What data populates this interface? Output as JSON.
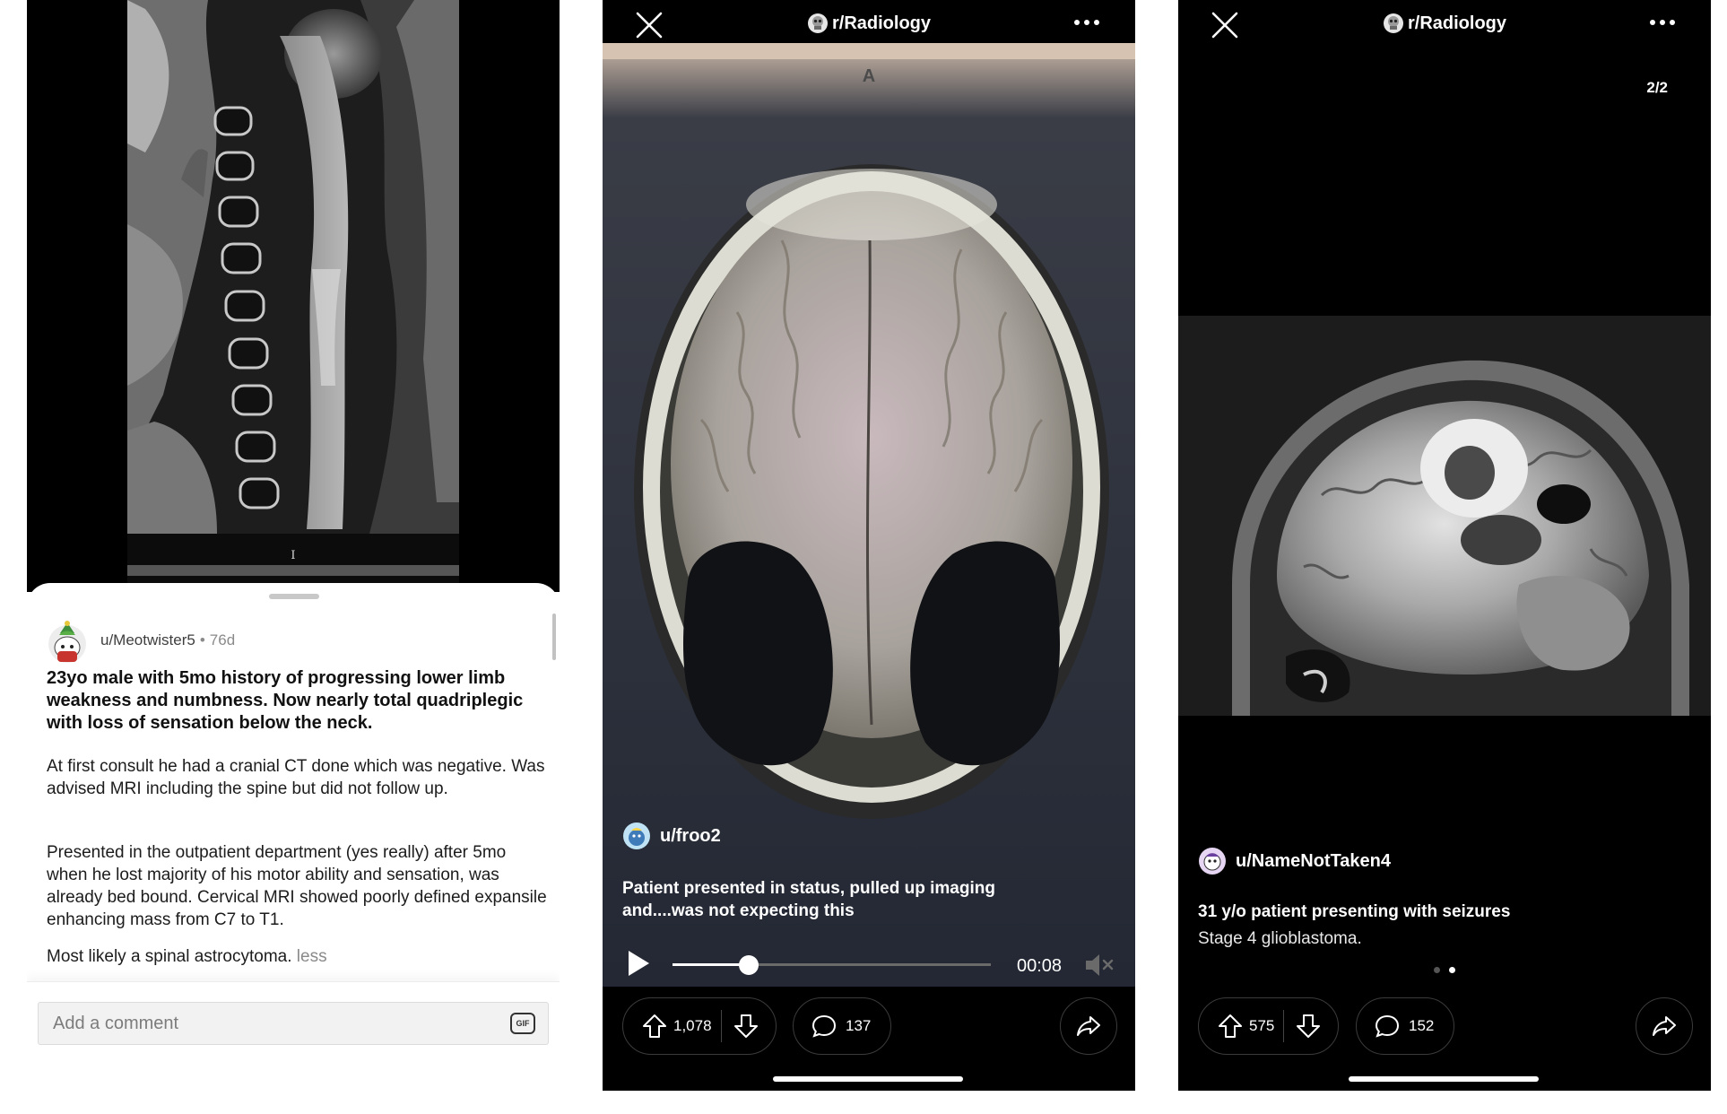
{
  "panel1": {
    "image_marker": "I",
    "post": {
      "author": "u/Meotwister5",
      "separator": "•",
      "age": "76d",
      "title": "23yo male with 5mo history of progressing lower limb weakness and numbness. Now nearly total quadriplegic with loss of sensation below the neck.",
      "paragraphs": [
        "At first consult he had a cranial CT done which was negative. Was advised MRI including the spine but did not follow up.",
        "Presented in the outpatient department (yes really) after 5mo when he lost majority of his motor ability and sensation, was already bed bound.  Cervical MRI showed poorly defined expansile enhancing mass from C7 to T1.",
        "Most likely a spinal astrocytoma."
      ],
      "less_label": "less"
    },
    "comment": {
      "placeholder": "Add a comment",
      "gif_label": "GIF"
    }
  },
  "panel2": {
    "subreddit": "r/Radiology",
    "image_marker": "A",
    "user": "u/froo2",
    "caption": "Patient presented in status, pulled up imaging and....was not expecting this",
    "video": {
      "time": "00:08",
      "progress": 0.24,
      "muted": true
    },
    "upvotes": "1,078",
    "comments": "137"
  },
  "panel3": {
    "subreddit": "r/Radiology",
    "page_counter": "2/2",
    "user": "u/NameNotTaken4",
    "title": "31 y/o patient presenting with seizures",
    "subtitle": "Stage 4 glioblastoma.",
    "pager": {
      "count": 2,
      "active": 1
    },
    "upvotes": "575",
    "comments": "152"
  },
  "colors": {
    "dark_bg": "#000000",
    "pill_border": "#3b3b3b",
    "muted_text": "#8a8a8a"
  }
}
